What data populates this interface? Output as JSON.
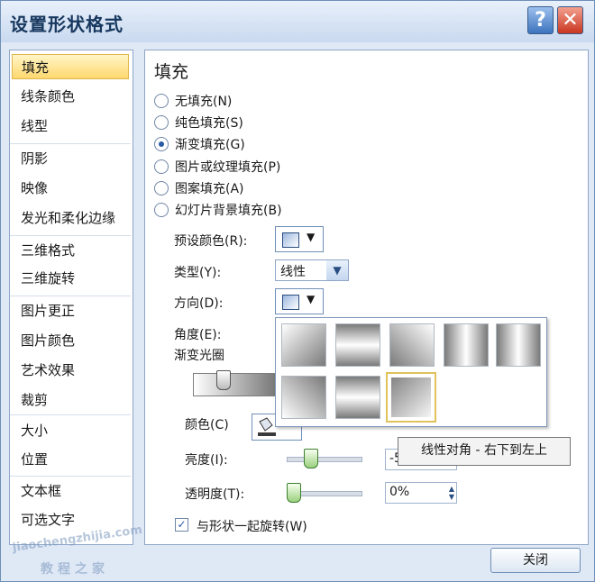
{
  "window": {
    "title": "设置形状格式",
    "help_glyph": "?",
    "close_glyph": "✕"
  },
  "nav": {
    "items": [
      "填充",
      "线条颜色",
      "线型",
      "阴影",
      "映像",
      "发光和柔化边缘",
      "三维格式",
      "三维旋转",
      "图片更正",
      "图片颜色",
      "艺术效果",
      "裁剪",
      "大小",
      "位置",
      "文本框",
      "可选文字"
    ],
    "selected": "填充"
  },
  "fill": {
    "heading": "填充",
    "options": [
      "无填充(N)",
      "纯色填充(S)",
      "渐变填充(G)",
      "图片或纹理填充(P)",
      "图案填充(A)",
      "幻灯片背景填充(B)"
    ],
    "selected_option": "渐变填充(G)",
    "preset_label": "预设颜色(R):",
    "type_label": "类型(Y):",
    "type_value": "线性",
    "direction_label": "方向(D):",
    "angle_label": "角度(E):",
    "stops_label": "渐变光圈",
    "color_label": "颜色(C)",
    "brightness_label": "亮度(I):",
    "brightness_value": "-5",
    "transparency_label": "透明度(T):",
    "transparency_value": "0%",
    "rotate_with_shape": "与形状一起旋转(W)",
    "rotate_checked": true
  },
  "tooltip": {
    "text": "线性对角 - 右下到左上"
  },
  "buttons": {
    "close": "关闭"
  },
  "watermark": {
    "line1": "jiaochengzhijia.com",
    "line2": "教程之家"
  },
  "icons": {
    "dropdown": "▼",
    "check": "✓",
    "spin_up": "▲",
    "spin_down": "▼"
  },
  "colors": {
    "title": "#17375e",
    "selected_nav": "#ffd76e",
    "help_button": "#3c73bd",
    "close_button": "#c9361f"
  }
}
